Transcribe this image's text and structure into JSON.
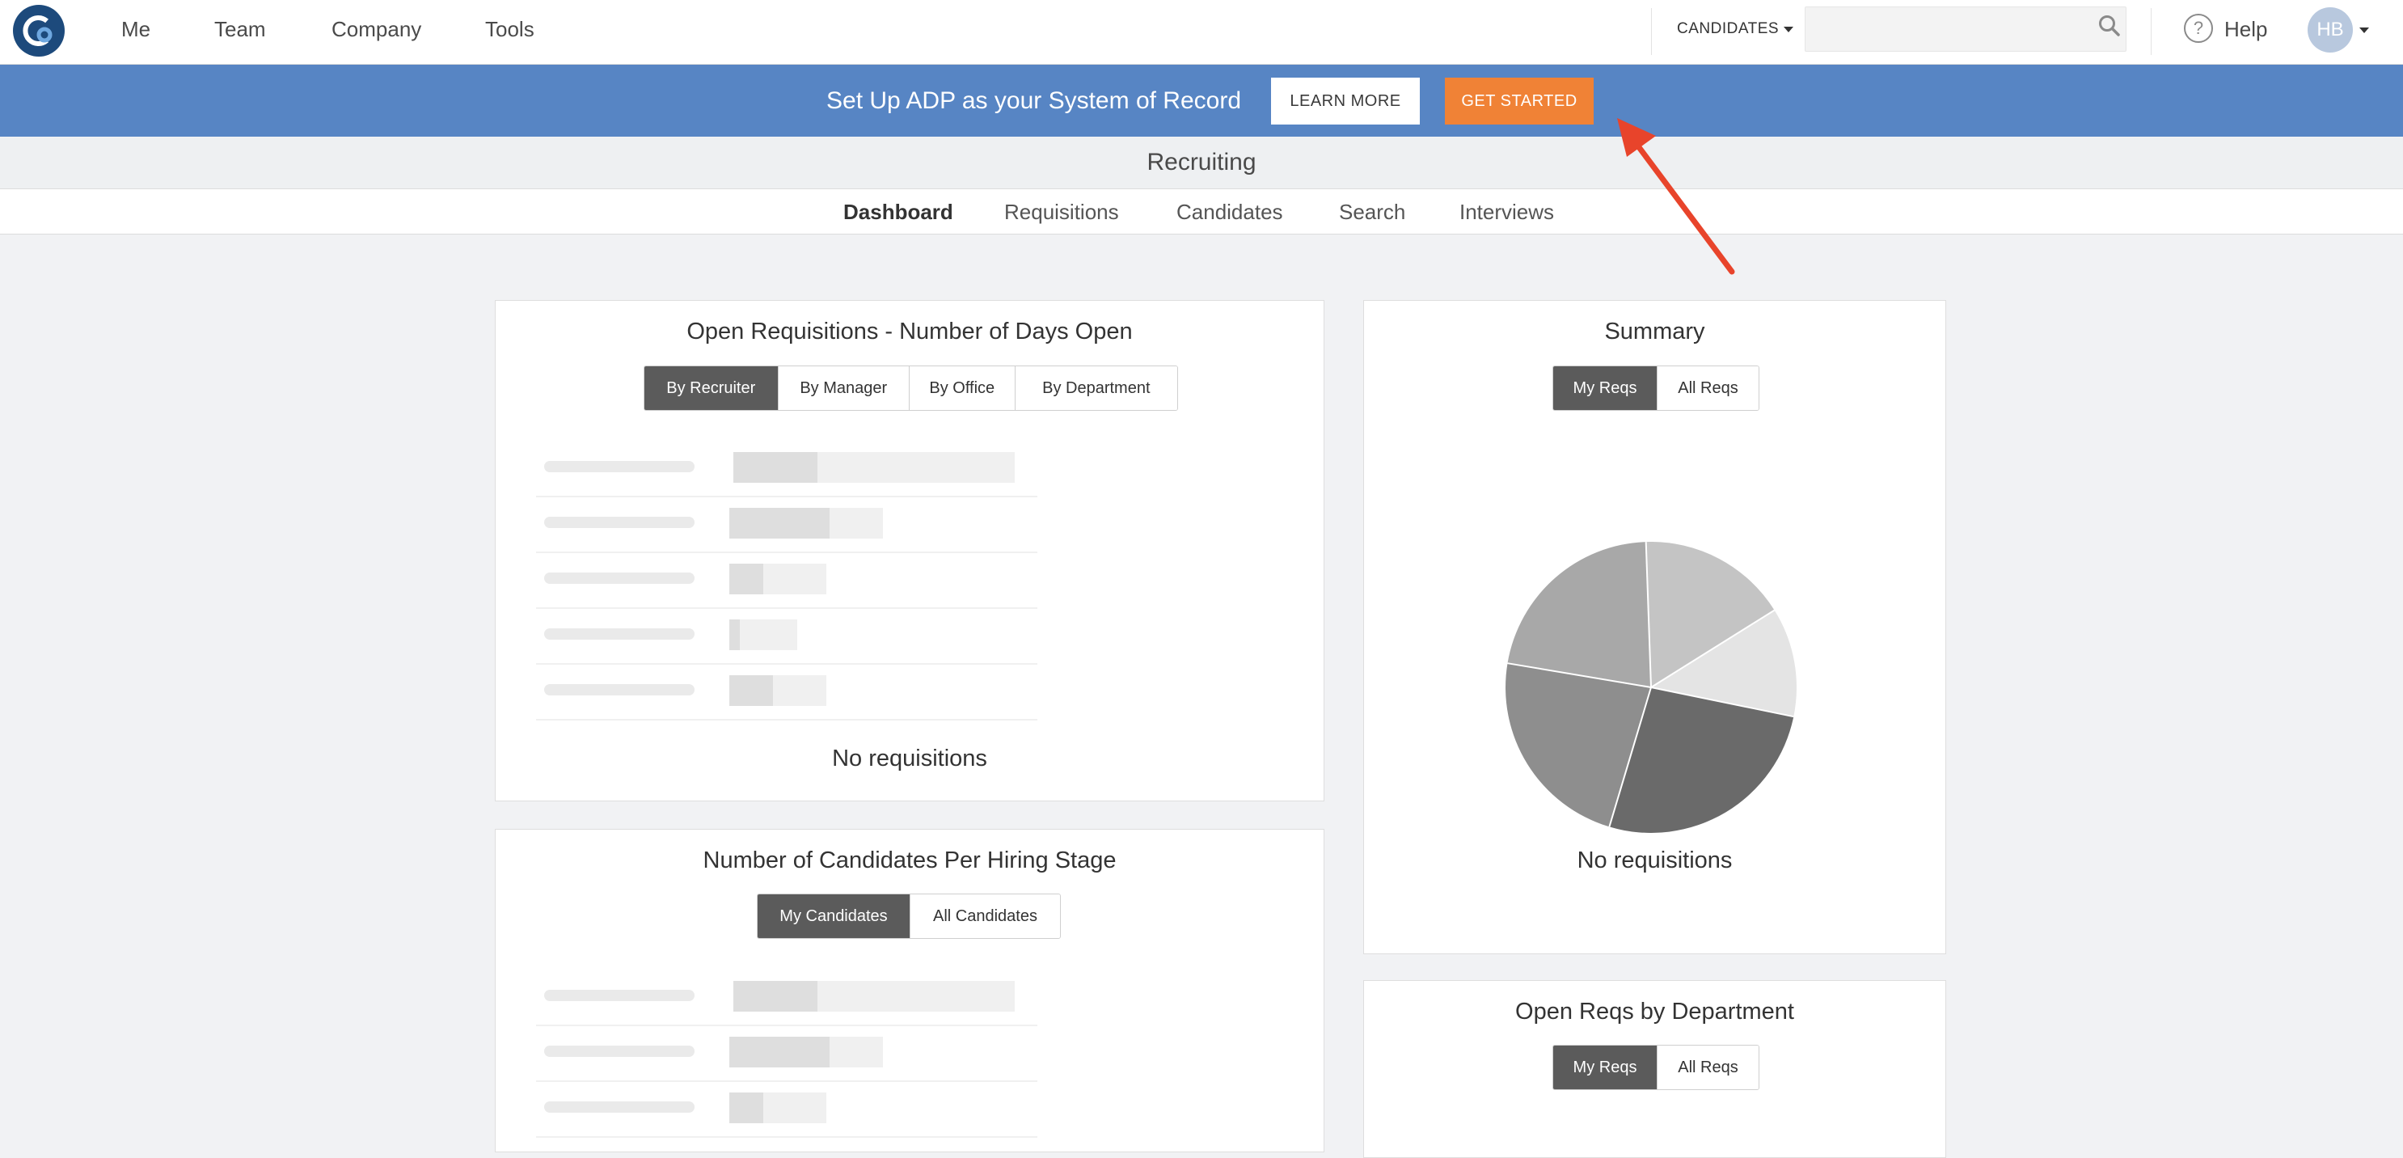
{
  "topnav": {
    "links": [
      "Me",
      "Team",
      "Company",
      "Tools"
    ],
    "candidates_dropdown": "CANDIDATES",
    "search_placeholder": "",
    "help_label": "Help",
    "avatar_initials": "HB"
  },
  "banner": {
    "text": "Set Up ADP as your System of Record",
    "learn_more": "LEARN MORE",
    "get_started": "GET STARTED"
  },
  "section": {
    "title": "Recruiting",
    "tabs": [
      "Dashboard",
      "Requisitions",
      "Candidates",
      "Search",
      "Interviews"
    ],
    "active_tab": "Dashboard"
  },
  "cards": {
    "open_reqs": {
      "title": "Open Requisitions - Number of Days Open",
      "toggles": [
        "By Recruiter",
        "By Manager",
        "By Office",
        "By Department"
      ],
      "selected": "By Recruiter",
      "placeholder_bar_levels": [
        0.3,
        0.65,
        0.35,
        0.15,
        0.45
      ],
      "empty": "No requisitions"
    },
    "candidates_per_stage": {
      "title": "Number of Candidates Per Hiring Stage",
      "toggles": [
        "My Candidates",
        "All Candidates"
      ],
      "selected": "My Candidates"
    },
    "summary": {
      "title": "Summary",
      "toggles": [
        "My Reqs",
        "All Reqs"
      ],
      "selected": "My Reqs",
      "empty": "No requisitions"
    },
    "open_reqs_by_dept": {
      "title": "Open Reqs by Department",
      "toggles": [
        "My Reqs",
        "All Reqs"
      ],
      "selected": "My Reqs"
    }
  },
  "colors": {
    "banner": "#5785c4",
    "get_started": "#f08236",
    "segment_active": "#5b5b5b",
    "annotation_arrow": "#e8442b"
  }
}
